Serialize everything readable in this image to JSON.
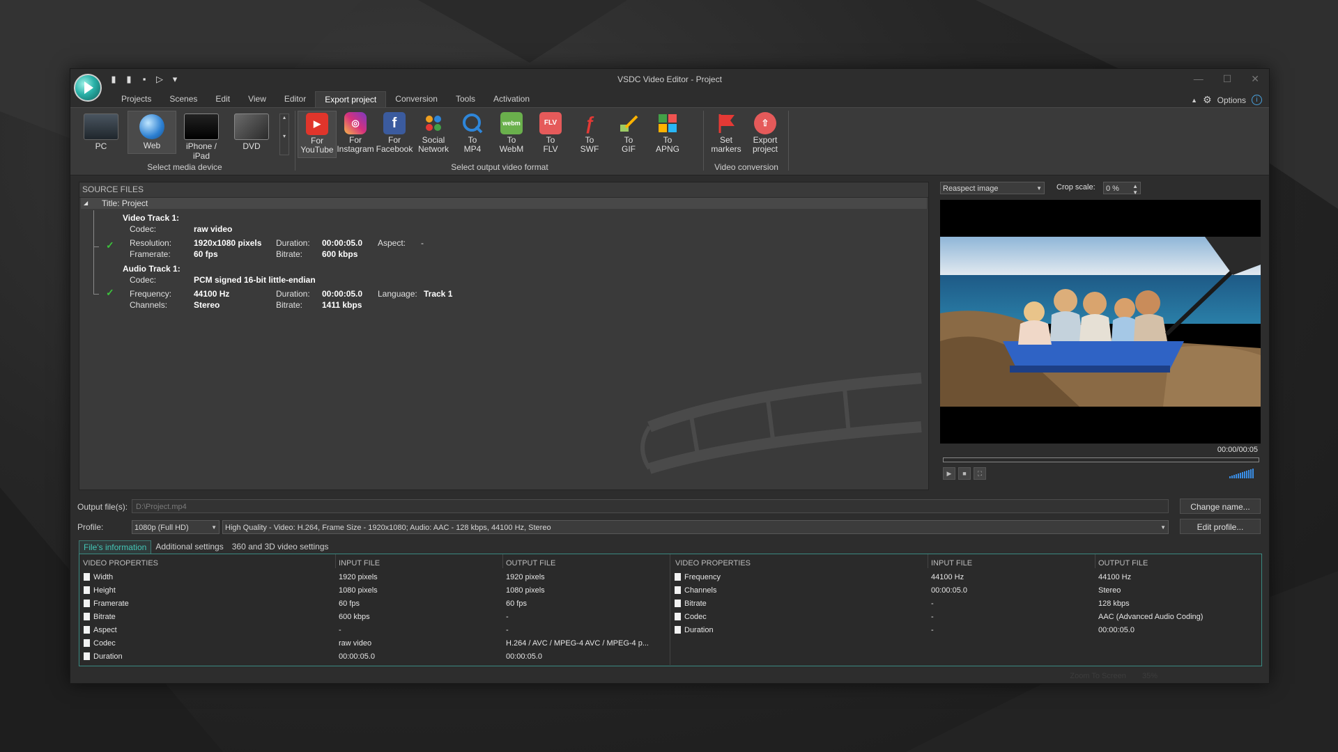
{
  "window": {
    "title": "VSDC Video Editor - Project",
    "controls": [
      "—",
      "☐",
      "✕"
    ]
  },
  "menu": {
    "tabs": [
      "Projects",
      "Scenes",
      "Edit",
      "View",
      "Editor",
      "Export project",
      "Conversion",
      "Tools",
      "Activation"
    ],
    "active": "Export project",
    "options_label": "Options"
  },
  "ribbon": {
    "devices": [
      {
        "label": "PC",
        "icon": "pc-icon"
      },
      {
        "label": "Web",
        "icon": "globe-icon"
      },
      {
        "label": "iPhone / iPad",
        "icon": "iphone-icon"
      },
      {
        "label": "DVD",
        "icon": "dvd-icon"
      }
    ],
    "devices_group_label": "Select media device",
    "formats": [
      {
        "line1": "For",
        "line2": "YouTube",
        "icon": "youtube-icon",
        "color": "#e0352b"
      },
      {
        "line1": "For",
        "line2": "Instagram",
        "icon": "instagram-icon",
        "color": "#c7378f"
      },
      {
        "line1": "For",
        "line2": "Facebook",
        "icon": "facebook-icon",
        "color": "#3b5b9e"
      },
      {
        "line1": "Social",
        "line2": "Network",
        "icon": "social-network-icon",
        "color": "#3a3a3a"
      },
      {
        "line1": "To",
        "line2": "MP4",
        "icon": "mp4-icon",
        "color": "#2e86d9"
      },
      {
        "line1": "To",
        "line2": "WebM",
        "icon": "webm-icon",
        "color": "#6ab04c"
      },
      {
        "line1": "To",
        "line2": "FLV",
        "icon": "flv-icon",
        "color": "#e55a5a"
      },
      {
        "line1": "To",
        "line2": "SWF",
        "icon": "swf-icon",
        "color": "#3a3a3a"
      },
      {
        "line1": "To",
        "line2": "GIF",
        "icon": "gif-icon",
        "color": "#3a3a3a"
      },
      {
        "line1": "To",
        "line2": "APNG",
        "icon": "apng-icon",
        "color": "#3a3a3a"
      }
    ],
    "formats_group_label": "Select output video format",
    "conversion": [
      {
        "line1": "Set",
        "line2": "markers",
        "icon": "flag-icon"
      },
      {
        "line1": "Export",
        "line2": "project",
        "icon": "export-icon"
      }
    ],
    "conversion_group_label": "Video conversion"
  },
  "source": {
    "header": "SOURCE FILES",
    "title_row": "Title: Project",
    "video_track": {
      "heading": "Video Track 1:",
      "codec_label": "Codec:",
      "codec": "raw video",
      "resolution_label": "Resolution:",
      "resolution": "1920x1080 pixels",
      "framerate_label": "Framerate:",
      "framerate": "60 fps",
      "duration_label": "Duration:",
      "duration": "00:00:05.0",
      "bitrate_label": "Bitrate:",
      "bitrate": "600 kbps",
      "aspect_label": "Aspect:",
      "aspect": "-"
    },
    "audio_track": {
      "heading": "Audio Track 1:",
      "codec_label": "Codec:",
      "codec": "PCM signed 16-bit little-endian",
      "frequency_label": "Frequency:",
      "frequency": "44100 Hz",
      "channels_label": "Channels:",
      "channels": "Stereo",
      "duration_label": "Duration:",
      "duration": "00:00:05.0",
      "bitrate_label": "Bitrate:",
      "bitrate": "1411 kbps",
      "language_label": "Language:",
      "language": "Track 1"
    }
  },
  "preview": {
    "mode": "Reaspect image",
    "crop_label": "Crop scale:",
    "crop_value": "0 %",
    "timecode": "00:00/00:05"
  },
  "output": {
    "file_label": "Output file(s):",
    "file_value": "D:\\Project.mp4",
    "change_name": "Change name...",
    "profile_label": "Profile:",
    "profile_value": "1080p (Full HD)",
    "profile_desc": "High Quality - Video: H.264, Frame Size - 1920x1080; Audio: AAC - 128 kbps, 44100 Hz, Stereo",
    "edit_profile": "Edit profile..."
  },
  "tabs": {
    "items": [
      "File's information",
      "Additional settings",
      "360 and 3D video settings"
    ],
    "active": "File's information"
  },
  "video_props": {
    "headers": [
      "VIDEO PROPERTIES",
      "INPUT FILE",
      "OUTPUT FILE"
    ],
    "rows": [
      [
        "Width",
        "1920 pixels",
        "1920 pixels"
      ],
      [
        "Height",
        "1080 pixels",
        "1080 pixels"
      ],
      [
        "Framerate",
        "60 fps",
        "60 fps"
      ],
      [
        "Bitrate",
        "600 kbps",
        "-"
      ],
      [
        "Aspect",
        "-",
        "-"
      ],
      [
        "Codec",
        "raw video",
        "H.264 / AVC / MPEG-4 AVC / MPEG-4 p..."
      ],
      [
        "Duration",
        "00:00:05.0",
        "00:00:05.0"
      ]
    ]
  },
  "audio_props": {
    "headers": [
      "VIDEO PROPERTIES",
      "INPUT FILE",
      "OUTPUT FILE"
    ],
    "rows": [
      [
        "Frequency",
        "44100 Hz",
        "44100 Hz"
      ],
      [
        "Channels",
        "00:00:05.0",
        "Stereo"
      ],
      [
        "Bitrate",
        "-",
        "128 kbps"
      ],
      [
        "Codec",
        "-",
        "AAC (Advanced Audio Coding)"
      ],
      [
        "Duration",
        "-",
        "00:00:05.0"
      ]
    ]
  },
  "status": {
    "zoom_label": "Zoom To Screen",
    "zoom_value": "35%"
  }
}
